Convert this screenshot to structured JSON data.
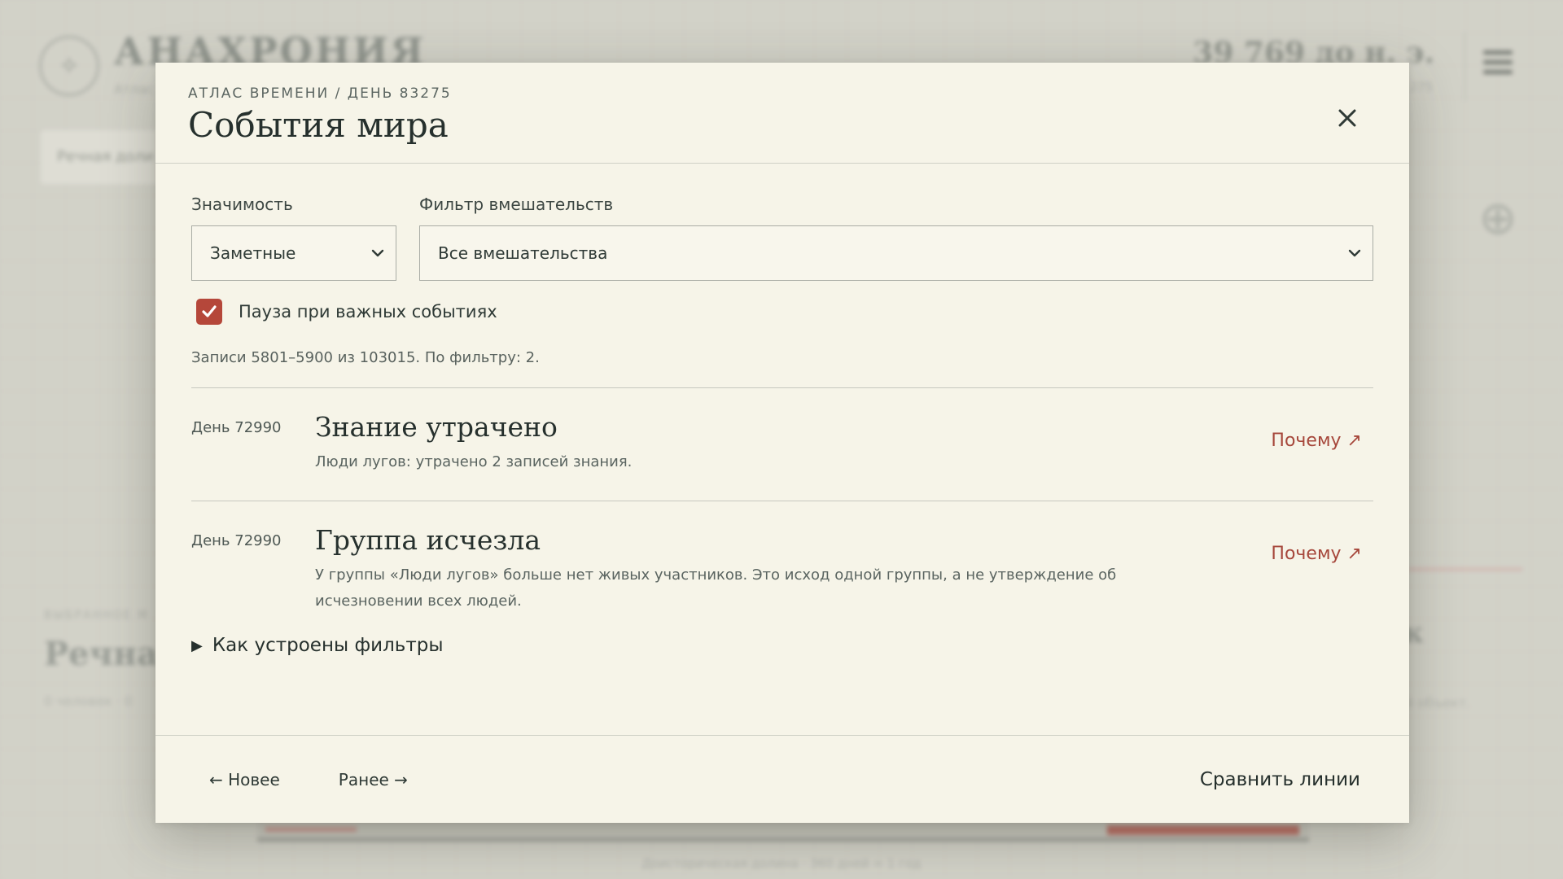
{
  "background": {
    "logo_text": "АНАХРОНИЯ",
    "logo_sub": "Атлас",
    "date": "39 769 до н. э.",
    "date_sub": "275",
    "tab_label": "Речная доли",
    "section_sub": "ВЫБРАННОЕ М",
    "section_title": "Речная",
    "section_meta": "0 человек · 0",
    "right_title": "к",
    "right_meta": "ай объект.",
    "bottom_caption": "Доисторическая долина · 360 дней = 1 год"
  },
  "modal": {
    "breadcrumb": "АТЛАС ВРЕМЕНИ / ДЕНЬ 83275",
    "title": "События мира",
    "filters": {
      "significance_label": "Значимость",
      "significance_value": "Заметные",
      "interventions_label": "Фильтр вмешательств",
      "interventions_value": "Все вмешательства"
    },
    "pause_checkbox": {
      "label": "Пауза при важных событиях",
      "checked": true
    },
    "records_info": "Записи 5801–5900 из 103015. По фильтру: 2.",
    "events": [
      {
        "day": "День 72990",
        "title": "Знание утрачено",
        "description": "Люди лугов: утрачено 2 записей знания.",
        "why_label": "Почему ↗"
      },
      {
        "day": "День 72990",
        "title": "Группа исчезла",
        "description": "У группы «Люди лугов» больше нет живых участников. Это исход одной группы, а не утверждение об исчезновении всех людей.",
        "why_label": "Почему ↗"
      }
    ],
    "details_label": "Как устроены фильтры",
    "footer": {
      "newer_label": "← Новее",
      "older_label": "Ранее →",
      "compare_label": "Сравнить линии"
    }
  },
  "colors": {
    "accent": "#b5473a",
    "link": "#a6473b",
    "modal_bg": "#f6f4e8"
  }
}
